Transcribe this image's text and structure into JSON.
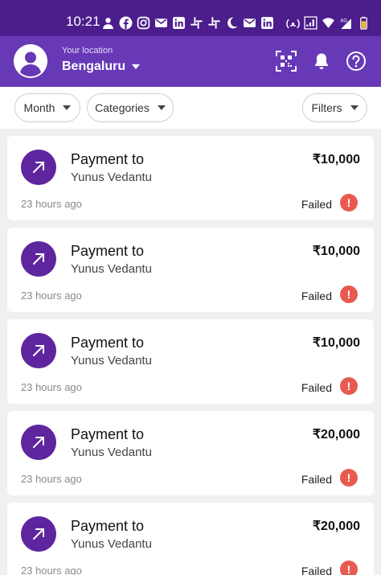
{
  "status_bar": {
    "time": "10:21",
    "icons": [
      "notification-person-icon",
      "facebook-icon",
      "instagram-icon",
      "gmail-icon",
      "linkedin-icon",
      "slack-icon",
      "slack-icon",
      "moon-icon",
      "gmail-icon",
      "linkedin-icon",
      "hotspot-icon",
      "signal-icon",
      "wifi-icon",
      "network-4g-icon",
      "battery-icon"
    ]
  },
  "header": {
    "location_label": "Your location",
    "city": "Bengaluru"
  },
  "filters": {
    "month": "Month",
    "categories": "Categories",
    "filters": "Filters"
  },
  "transactions": [
    {
      "title": "Payment to",
      "name": "Yunus Vedantu",
      "amount": "₹10,000",
      "time": "23 hours ago",
      "status": "Failed"
    },
    {
      "title": "Payment to",
      "name": "Yunus Vedantu",
      "amount": "₹10,000",
      "time": "23 hours ago",
      "status": "Failed"
    },
    {
      "title": "Payment to",
      "name": "Yunus Vedantu",
      "amount": "₹10,000",
      "time": "23 hours ago",
      "status": "Failed"
    },
    {
      "title": "Payment to",
      "name": "Yunus Vedantu",
      "amount": "₹20,000",
      "time": "23 hours ago",
      "status": "Failed"
    },
    {
      "title": "Payment to",
      "name": "Yunus Vedantu",
      "amount": "₹20,000",
      "time": "23 hours ago",
      "status": "Failed"
    }
  ],
  "colors": {
    "status_bar": "#4c1d8c",
    "app_bar": "#6739b7",
    "accent": "#5f259f",
    "failed": "#e85a4f"
  }
}
